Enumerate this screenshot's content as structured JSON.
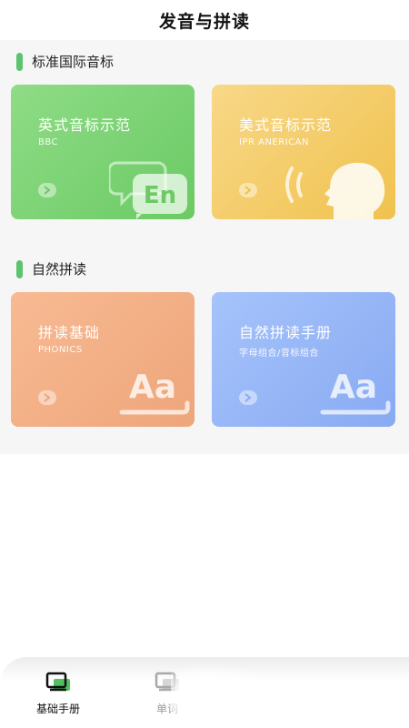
{
  "header": {
    "title": "发音与拼读"
  },
  "sections": [
    {
      "title": "标准国际音标"
    },
    {
      "title": "自然拼读"
    }
  ],
  "cards": [
    {
      "title": "英式音标示范",
      "subtitle": "BBC",
      "icon": "speech-bubble-en-icon",
      "icon_text": "En",
      "color": "#75cf6b"
    },
    {
      "title": "美式音标示范",
      "subtitle": "IPR ANERICAN",
      "icon": "speaking-head-icon",
      "color": "#f3c85f"
    },
    {
      "title": "拼读基础",
      "subtitle": "PHONICS",
      "icon": "aa-letters-icon",
      "icon_text": "Aa",
      "color": "#f1ac83"
    },
    {
      "title": "自然拼读手册",
      "subtitle": "字母组合/音标组合",
      "icon": "aa-letters-icon",
      "icon_text": "Aa",
      "color": "#94b3f6"
    }
  ],
  "tabbar": {
    "items": [
      {
        "label": "基础手册",
        "icon": "book-icon",
        "active": true
      },
      {
        "label": "单词",
        "icon": "word-book-icon",
        "active": false
      }
    ]
  }
}
